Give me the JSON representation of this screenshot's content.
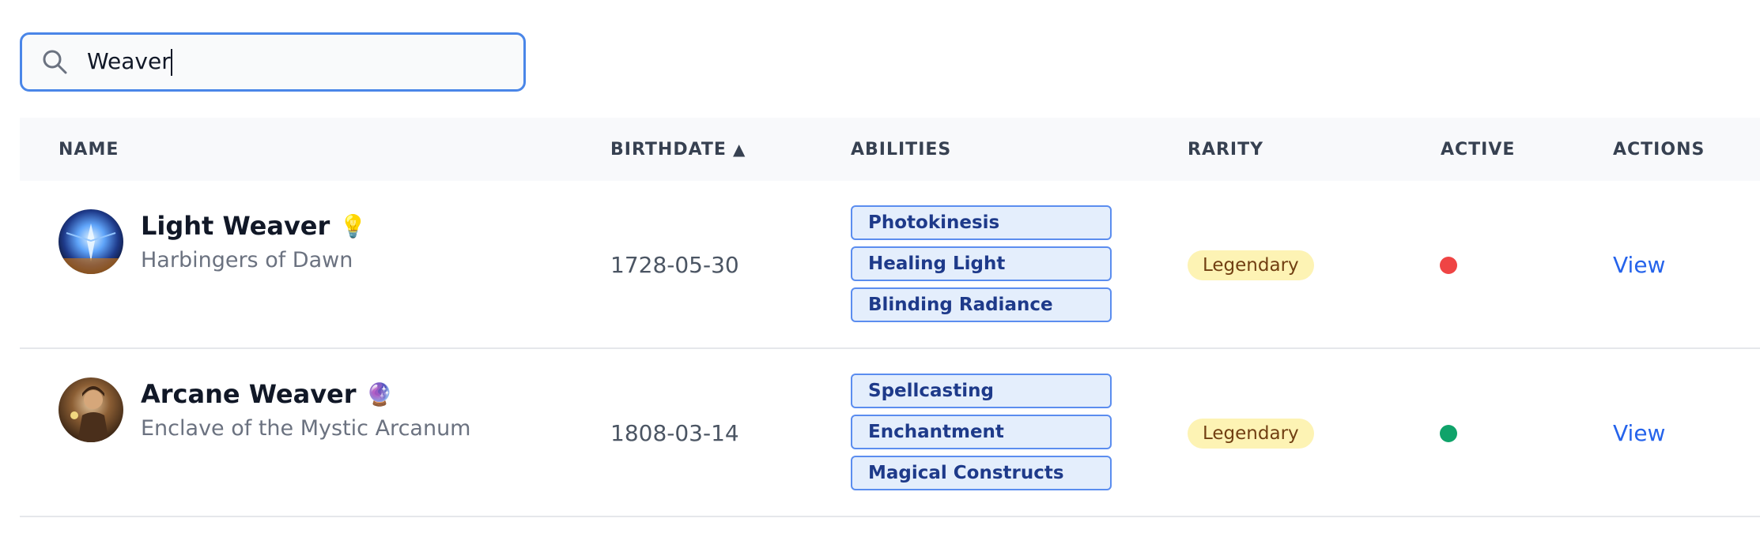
{
  "search": {
    "value": "Weaver",
    "icon": "search-icon"
  },
  "table": {
    "columns": {
      "name": "NAME",
      "birthdate": "BIRTHDATE",
      "birthdate_sort_indicator": "▲",
      "abilities": "ABILITIES",
      "rarity": "RARITY",
      "active": "ACTIVE",
      "actions": "ACTIONS"
    },
    "rows": [
      {
        "name": "Light Weaver",
        "emoji": "💡",
        "faction": "Harbingers of Dawn",
        "birthdate": "1728-05-30",
        "abilities": [
          "Photokinesis",
          "Healing Light",
          "Blinding Radiance"
        ],
        "rarity": "Legendary",
        "active": false,
        "active_color": "#ef4444",
        "action": "View"
      },
      {
        "name": "Arcane Weaver",
        "emoji": "🔮",
        "faction": "Enclave of the Mystic Arcanum",
        "birthdate": "1808-03-14",
        "abilities": [
          "Spellcasting",
          "Enchantment",
          "Magical Constructs"
        ],
        "rarity": "Legendary",
        "active": true,
        "active_color": "#10a36a",
        "action": "View"
      }
    ]
  },
  "colors": {
    "accent": "#4a86e8",
    "link": "#2563eb",
    "ability_bg": "#e4eefc",
    "ability_border": "#5b8def",
    "rarity_bg": "#fdf3b4"
  }
}
